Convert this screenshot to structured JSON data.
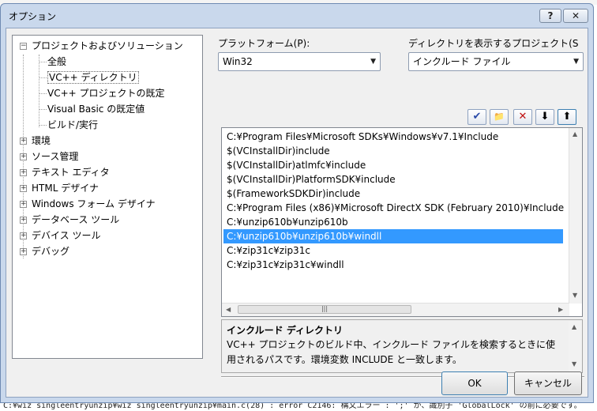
{
  "window": {
    "title": "オプション",
    "help_label": "?",
    "close_label": "✕"
  },
  "tree": {
    "root_label": "プロジェクトおよびソリューション",
    "children": [
      "全般",
      "VC++ ディレクトリ",
      "VC++ プロジェクトの既定",
      "Visual Basic の既定値",
      "ビルド/実行"
    ],
    "siblings": [
      "環境",
      "ソース管理",
      "テキスト エディタ",
      "HTML デザイナ",
      "Windows フォーム デザイナ",
      "データベース ツール",
      "デバイス ツール",
      "デバッグ"
    ],
    "selected": "VC++ ディレクトリ"
  },
  "platform": {
    "label": "プラットフォーム(P):",
    "value": "Win32"
  },
  "directory_for": {
    "label": "ディレクトリを表示するプロジェクト(S",
    "value": "インクルード ファイル"
  },
  "toolbar": {
    "check_icon": "✔",
    "folder_icon": "📁",
    "delete_icon": "✕",
    "down_icon": "⬇",
    "up_icon": "⬆"
  },
  "paths": [
    "C:¥Program Files¥Microsoft SDKs¥Windows¥v7.1¥Include",
    "$(VCInstallDir)include",
    "$(VCInstallDir)atlmfc¥include",
    "$(VCInstallDir)PlatformSDK¥include",
    "$(FrameworkSDKDir)include",
    "C:¥Program Files (x86)¥Microsoft DirectX SDK (February 2010)¥Include",
    "C:¥unzip610b¥unzip610b",
    "C:¥unzip610b¥unzip610b¥windll",
    "C:¥zip31c¥zip31c",
    "C:¥zip31c¥zip31c¥windll"
  ],
  "selected_path_index": 7,
  "description": {
    "title": "インクルード ディレクトリ",
    "text": "VC++ プロジェクトのビルド中、インクルード ファイルを検索するときに使用されるパスです。環境変数 INCLUDE と一致します。"
  },
  "buttons": {
    "ok": "OK",
    "cancel": "キャンセル"
  },
  "background_text": "C:¥wiz singleentryunzip¥wiz singleentryunzip¥main.c(28) : error C2146: 構文エラー : ';' が、識別子 'GlobalLock' の前に必要です。"
}
